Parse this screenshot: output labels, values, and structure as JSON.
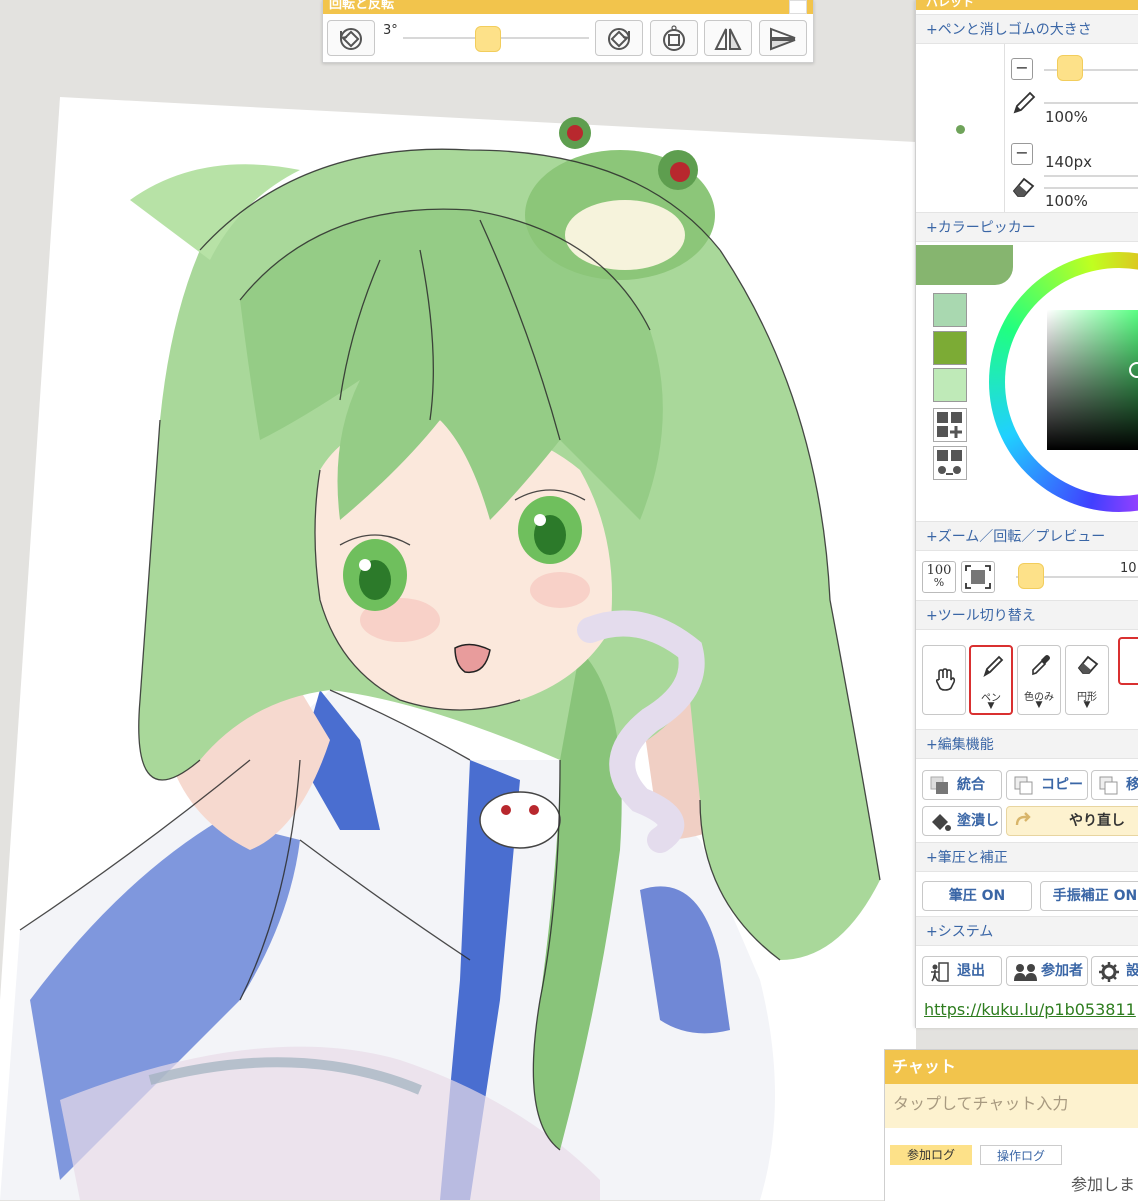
{
  "rotate_panel": {
    "title": "回転と反転",
    "angle": "3°"
  },
  "palette": {
    "title": "パレット",
    "sections": {
      "pen_size": "+ペンと消しゴムの大きさ",
      "color_picker": "+カラーピッカー",
      "zoom": "+ズーム／回転／プレビュー",
      "tool_switch": "+ツール切り替え",
      "edit": "+編集機能",
      "pressure": "+筆圧と補正",
      "system": "+システム"
    },
    "pen": {
      "opacity": "100%"
    },
    "eraser": {
      "size": "140px",
      "opacity": "100%"
    },
    "swatches": [
      "#a9d8b0",
      "#7cab35",
      "#bfeab8"
    ],
    "current_color": "#86b56f",
    "zoom": {
      "percent_icon": "100",
      "percent_sign": "%",
      "value": "10"
    },
    "tools": {
      "pen": "ペン",
      "color_only": "色のみ",
      "circle": "円形"
    },
    "edit": {
      "merge": "統合",
      "copy": "コピー",
      "move": "移",
      "fill": "塗潰し",
      "redo": "やり直し"
    },
    "pressure": {
      "pressure_on": "筆圧 ON",
      "stabilizer_on": "手振補正 ON"
    },
    "system": {
      "exit": "退出",
      "participants": "参加者",
      "settings": "設"
    },
    "url": "https://kuku.lu/p1b053811"
  },
  "chat": {
    "title": "チャット",
    "input_placeholder": "タップしてチャット入力",
    "tab_join_log": "参加ログ",
    "tab_action_log": "操作ログ",
    "log_text": "参加しま"
  }
}
